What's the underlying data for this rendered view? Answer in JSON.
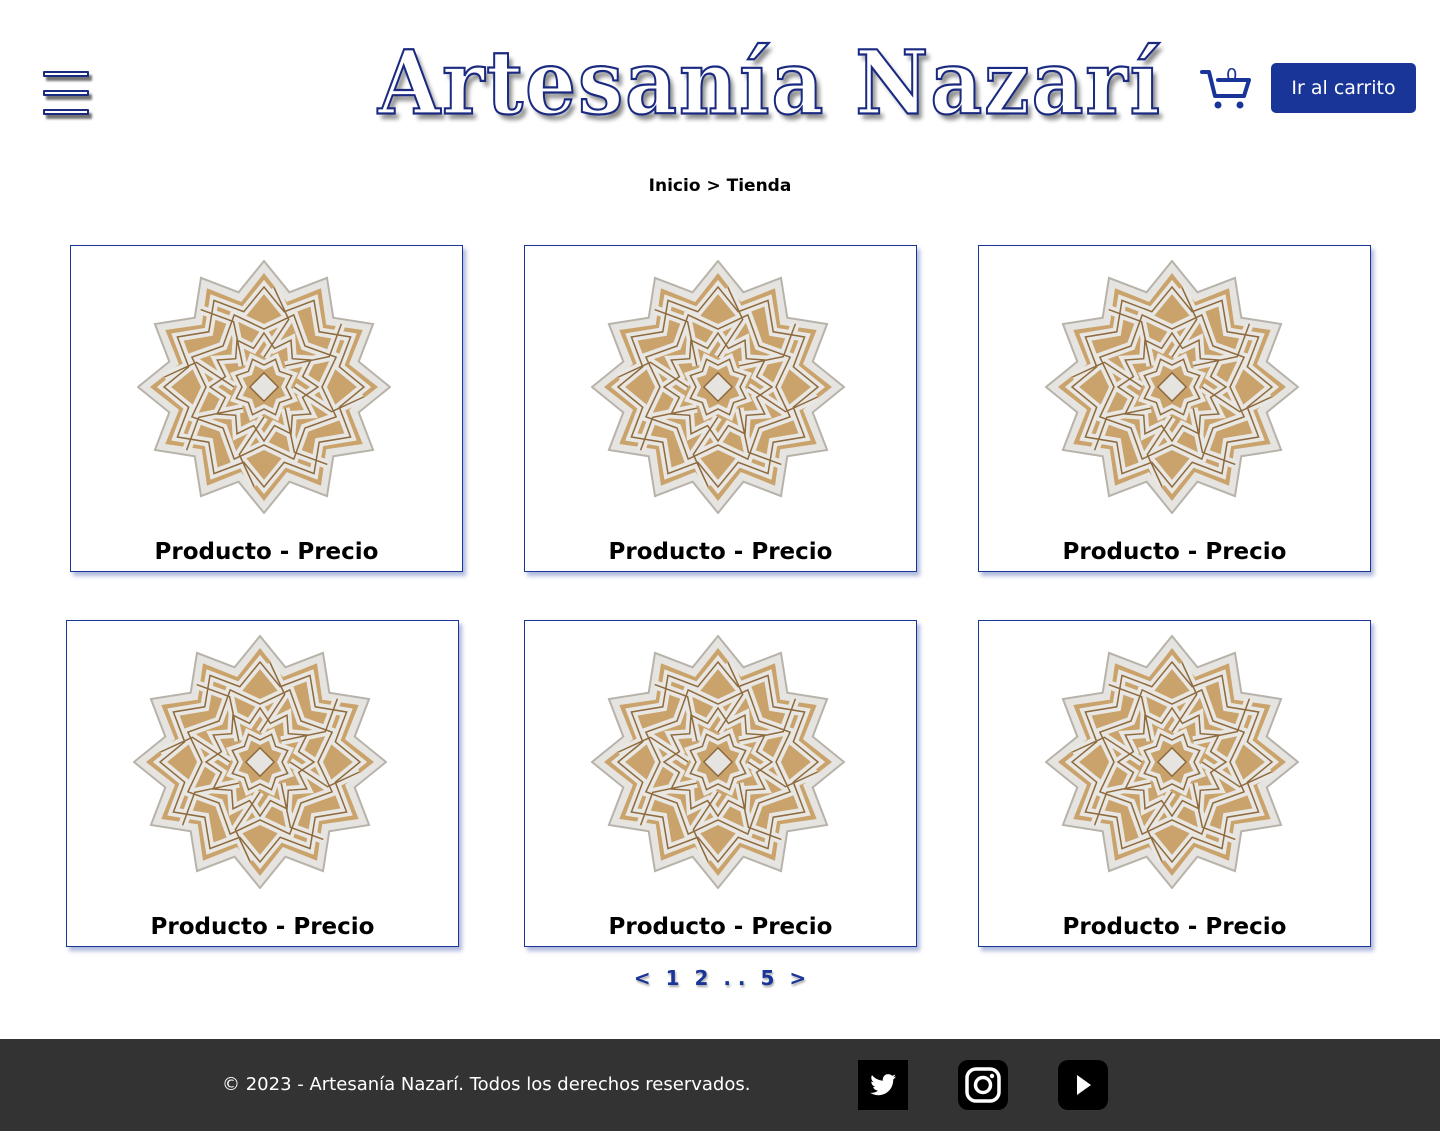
{
  "header": {
    "logo_text": "Artesanía Nazarí",
    "cart_count": "0",
    "cart_button_label": "Ir al carrito"
  },
  "breadcrumb": {
    "home": "Inicio",
    "separator": ">",
    "current": "Tienda"
  },
  "products": [
    {
      "label": "Producto - Precio"
    },
    {
      "label": "Producto - Precio"
    },
    {
      "label": "Producto - Precio"
    },
    {
      "label": "Producto - Precio"
    },
    {
      "label": "Producto - Precio"
    },
    {
      "label": "Producto - Precio"
    }
  ],
  "pagination": {
    "prev": "<",
    "pages": [
      "1",
      "2",
      ". .",
      "5"
    ],
    "next": ">"
  },
  "footer": {
    "copyright": "© 2023 - Artesanía Nazarí. Todos los derechos reservados.",
    "social": [
      "twitter-icon",
      "instagram-icon",
      "youtube-icon"
    ]
  },
  "colors": {
    "accent": "#1a3598",
    "footer_bg": "#333333",
    "tile_beige": "#c9a36b",
    "tile_white": "#e8e8e6"
  }
}
